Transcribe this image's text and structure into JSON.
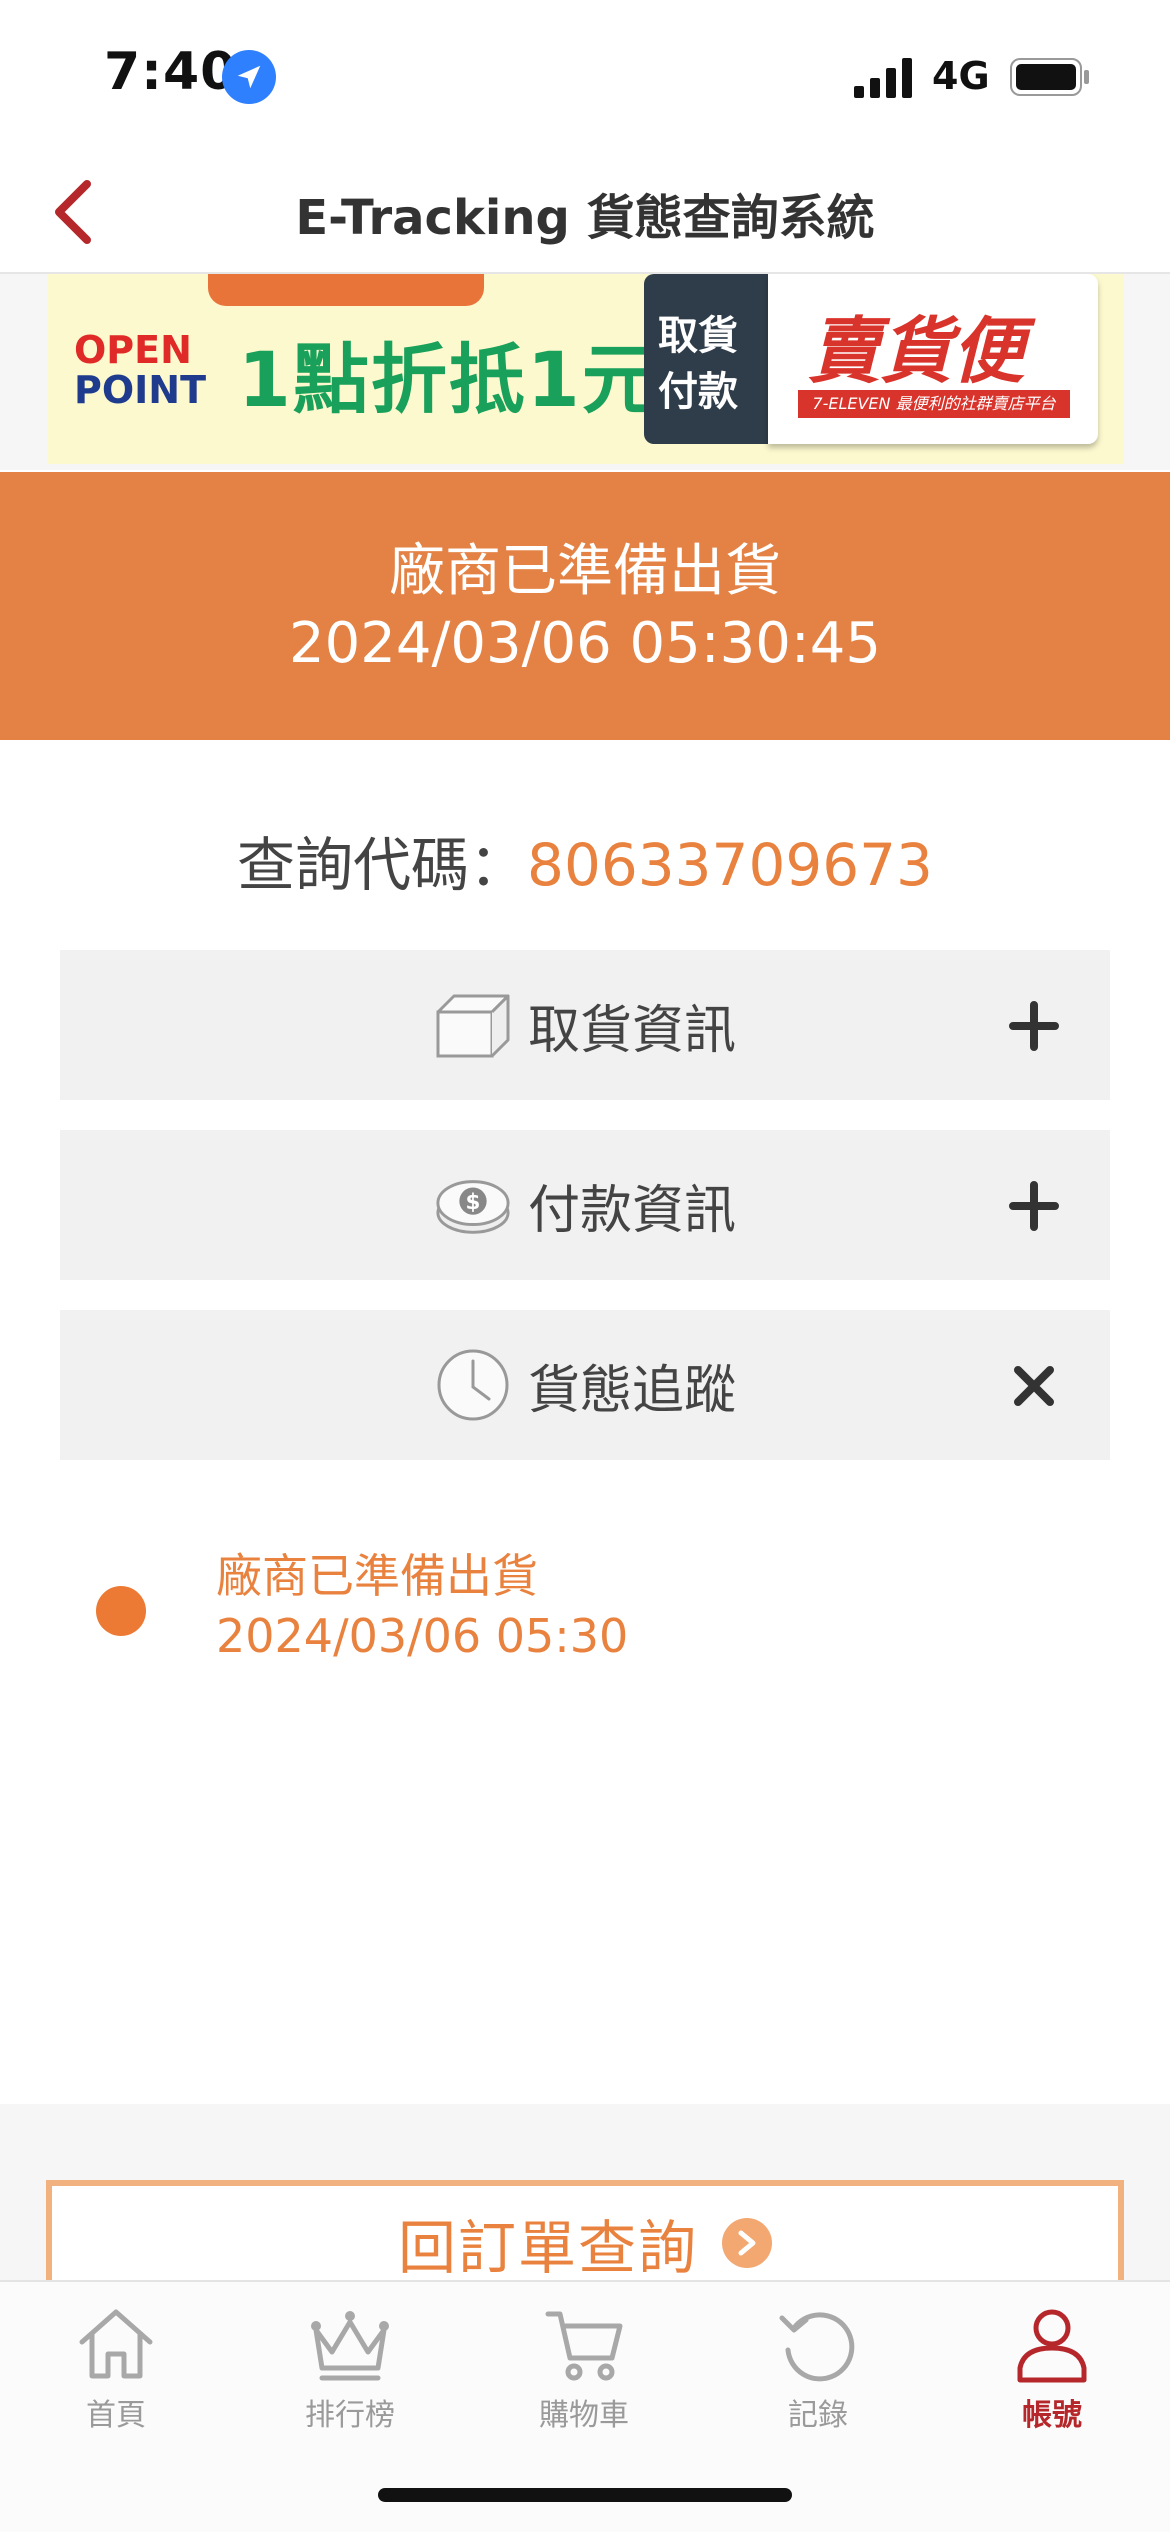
{
  "status_bar": {
    "time": "7:40",
    "network": "4G"
  },
  "header": {
    "title": "E-Tracking 貨態查詢系統"
  },
  "banner": {
    "open": "OPEN",
    "point": "POINT",
    "promo": "1點折抵1元",
    "pickup_line1": "取貨",
    "pickup_line2": "付款",
    "brand": "賣貨便",
    "brand_sub": "7-ELEVEN 最便利的社群賣店平台"
  },
  "status": {
    "title": "廠商已準備出貨",
    "datetime": "2024/03/06 05:30:45"
  },
  "query": {
    "label": "查詢代碼：",
    "code": "80633709673"
  },
  "accordions": [
    {
      "label": "取貨資訊",
      "icon": "box-icon",
      "state": "collapsed"
    },
    {
      "label": "付款資訊",
      "icon": "coin-icon",
      "state": "collapsed"
    },
    {
      "label": "貨態追蹤",
      "icon": "clock-icon",
      "state": "expanded"
    }
  ],
  "timeline": [
    {
      "status": "廠商已準備出貨",
      "datetime": "2024/03/06 05:30"
    }
  ],
  "return_button": {
    "label": "回訂單查詢"
  },
  "tabs": [
    {
      "label": "首頁",
      "icon": "home-icon"
    },
    {
      "label": "排行榜",
      "icon": "crown-icon"
    },
    {
      "label": "購物車",
      "icon": "cart-icon"
    },
    {
      "label": "記錄",
      "icon": "history-icon"
    },
    {
      "label": "帳號",
      "icon": "account-icon",
      "active": true
    }
  ],
  "colors": {
    "accent": "#e38244",
    "accent_text": "#e8823e",
    "brand_red": "#b5272b",
    "panel_gray": "#f1f1f1"
  }
}
